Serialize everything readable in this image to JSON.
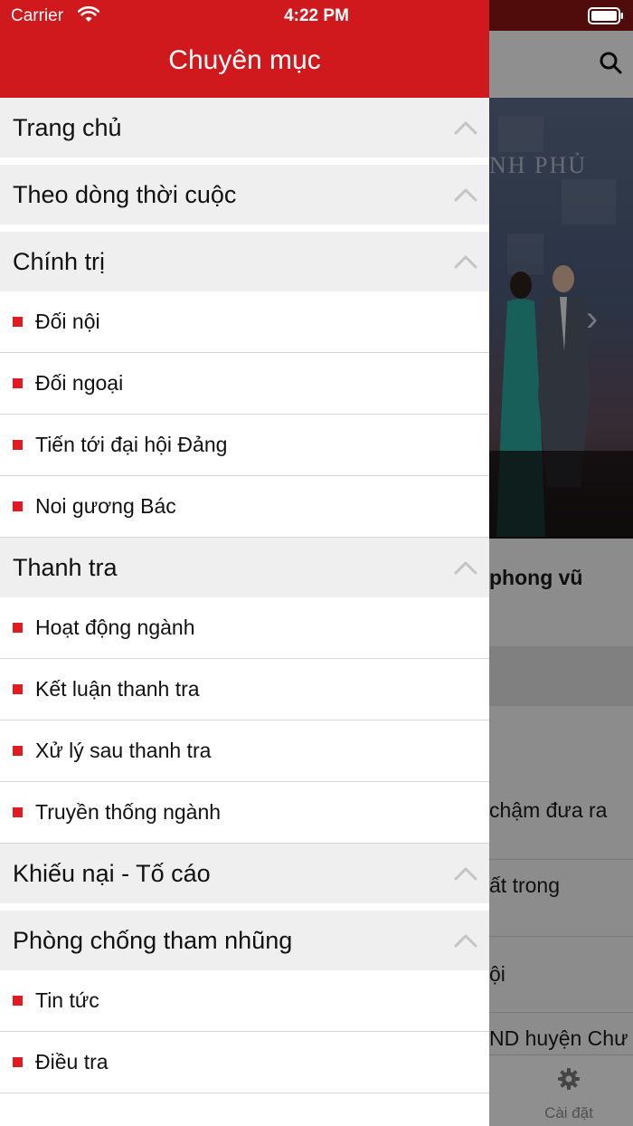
{
  "status_bar": {
    "carrier": "Carrier",
    "time": "4:22 PM"
  },
  "drawer": {
    "title": "Chuyên mục",
    "accent_color": "#d0191d",
    "bullet_color": "#e01b22"
  },
  "menu": {
    "sections": [
      {
        "label": "Trang chủ",
        "icon": "chevron-up-icon",
        "items": []
      },
      {
        "label": "Theo dòng thời cuộc",
        "icon": "chevron-up-icon",
        "items": []
      },
      {
        "label": "Chính trị",
        "icon": "chevron-up-icon",
        "items": [
          {
            "label": "Đối nội"
          },
          {
            "label": "Đối ngoại"
          },
          {
            "label": "Tiến tới đại hội Đảng"
          },
          {
            "label": "Noi gương Bác"
          }
        ]
      },
      {
        "label": "Thanh tra",
        "icon": "chevron-up-icon",
        "items": [
          {
            "label": "Hoạt động ngành"
          },
          {
            "label": "Kết luận thanh tra"
          },
          {
            "label": "Xử lý sau thanh tra"
          },
          {
            "label": "Truyền thống ngành"
          }
        ]
      },
      {
        "label": "Khiếu nại - Tố cáo",
        "icon": "chevron-up-icon",
        "items": []
      },
      {
        "label": "Phòng chống tham nhũng",
        "icon": "chevron-up-icon",
        "items": [
          {
            "label": "Tin tức"
          },
          {
            "label": "Điều tra"
          }
        ]
      }
    ]
  },
  "background": {
    "hero_text": "NH PHỦ",
    "headline": "phong vũ",
    "rows": [
      "chậm đưa ra",
      "ất trong",
      "ội",
      "ND huyện Chư"
    ],
    "tab_settings_label": "Cài đặt",
    "icons": [
      "search-icon",
      "gear-icon",
      "chevron-right-icon"
    ]
  }
}
